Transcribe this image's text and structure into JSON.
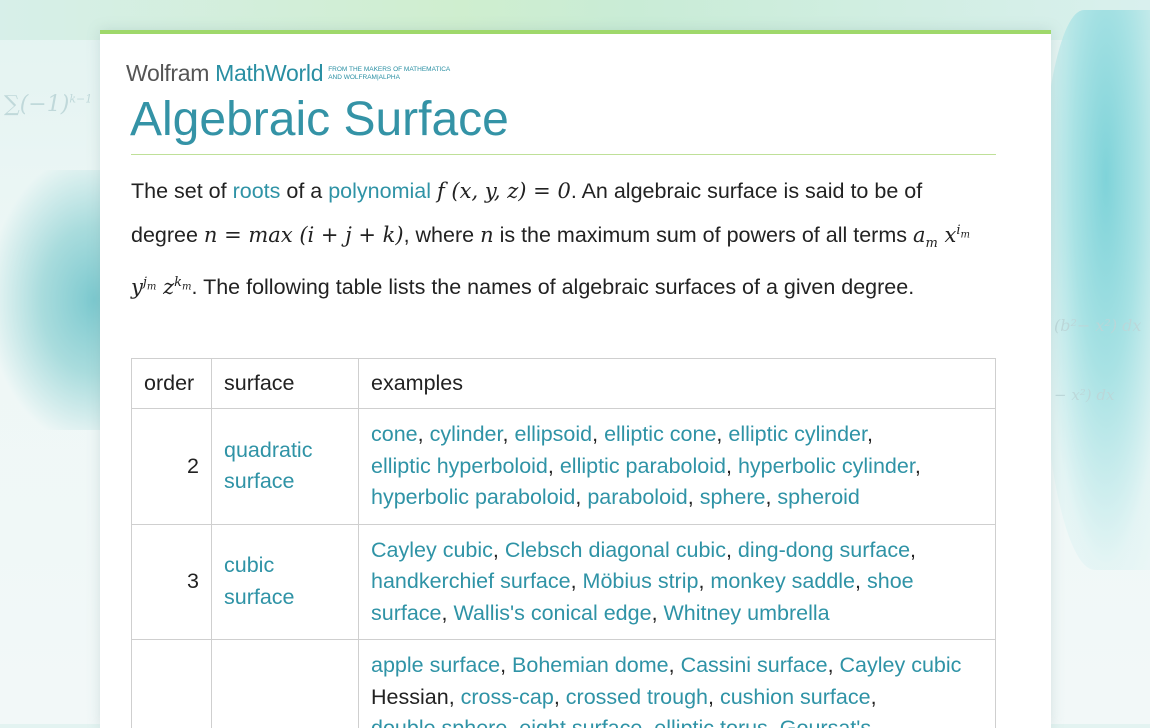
{
  "brand": {
    "wolfram": "Wolfram",
    "mathworld": "MathWorld",
    "tagline_1": "FROM THE MAKERS OF MATHEMATICA",
    "tagline_2": "AND WOLFRAM|ALPHA"
  },
  "page": {
    "title": "Algebraic Surface"
  },
  "intro": {
    "t1": "The set of ",
    "link_roots": "roots",
    "t2": " of a ",
    "link_polynomial": "polynomial",
    "eq1": "f (x, y, z) = 0",
    "t3": ". An algebraic surface is said to be of degree ",
    "eq2": "n = max (i + j + k)",
    "t4": ", where ",
    "var_n": "n",
    "t5": " is the maximum sum of powers of all terms ",
    "t6": ". The following table lists the names of algebraic surfaces of a given degree."
  },
  "table": {
    "headers": [
      "order",
      "surface",
      "examples"
    ],
    "rows": [
      {
        "order": "2",
        "surface": [
          "quadratic",
          "surface"
        ],
        "examples": [
          "cone",
          "cylinder",
          "ellipsoid",
          "elliptic cone",
          "elliptic cylinder",
          "elliptic hyperboloid",
          "elliptic paraboloid",
          "hyperbolic cylinder",
          "hyperbolic paraboloid",
          "paraboloid",
          "sphere",
          "spheroid"
        ]
      },
      {
        "order": "3",
        "surface": [
          "cubic",
          "surface"
        ],
        "examples": [
          "Cayley cubic",
          "Clebsch diagonal cubic",
          "ding-dong surface",
          "handkerchief surface",
          "Möbius strip",
          "monkey saddle",
          "shoe surface",
          "Wallis's conical edge",
          "Whitney umbrella"
        ]
      },
      {
        "order": "",
        "surface": [],
        "examples_a": [
          "apple surface",
          "Bohemian dome",
          "Cassini surface",
          "Cayley cubic"
        ],
        "examples_plain": "Hessian",
        "examples_b": [
          "cross-cap",
          "crossed trough",
          "cushion surface",
          "double sphere",
          "eight surface",
          "elliptic torus",
          "Goursat's"
        ]
      }
    ]
  }
}
